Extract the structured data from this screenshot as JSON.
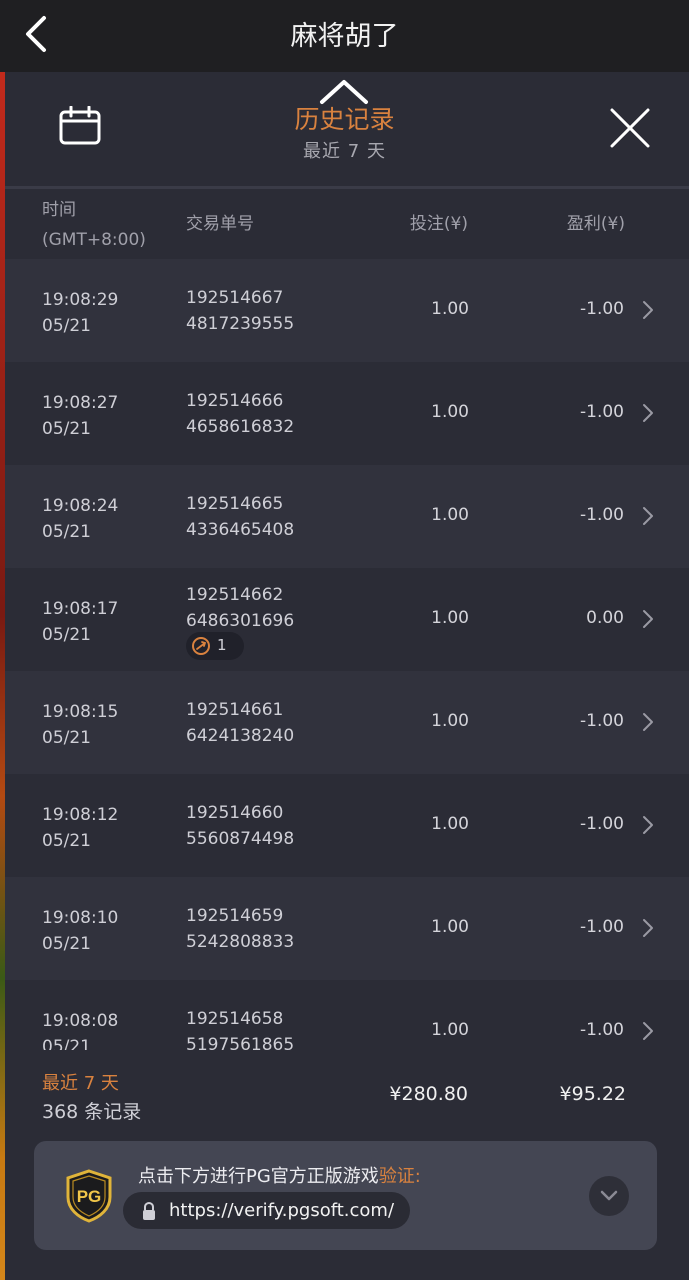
{
  "app": {
    "title": "麻将胡了"
  },
  "panel": {
    "title": "历史记录",
    "subtitle": "最近 7 天",
    "title_color": "#d9823f"
  },
  "columns": {
    "time_line1": "时间",
    "time_line2": "(GMT+8:00)",
    "transaction": "交易单号",
    "bet": "投注(¥)",
    "profit": "盈利(¥)"
  },
  "rows": [
    {
      "time": "19:08:29",
      "date": "05/21",
      "tx1": "192514667",
      "tx2": "4817239555",
      "bet": "1.00",
      "profit": "-1.00"
    },
    {
      "time": "19:08:27",
      "date": "05/21",
      "tx1": "192514666",
      "tx2": "4658616832",
      "bet": "1.00",
      "profit": "-1.00"
    },
    {
      "time": "19:08:24",
      "date": "05/21",
      "tx1": "192514665",
      "tx2": "4336465408",
      "bet": "1.00",
      "profit": "-1.00"
    },
    {
      "time": "19:08:17",
      "date": "05/21",
      "tx1": "192514662",
      "tx2": "6486301696",
      "bet": "1.00",
      "profit": "0.00",
      "badge": "1"
    },
    {
      "time": "19:08:15",
      "date": "05/21",
      "tx1": "192514661",
      "tx2": "6424138240",
      "bet": "1.00",
      "profit": "-1.00"
    },
    {
      "time": "19:08:12",
      "date": "05/21",
      "tx1": "192514660",
      "tx2": "5560874498",
      "bet": "1.00",
      "profit": "-1.00"
    },
    {
      "time": "19:08:10",
      "date": "05/21",
      "tx1": "192514659",
      "tx2": "5242808833",
      "bet": "1.00",
      "profit": "-1.00"
    },
    {
      "time": "19:08:08",
      "date": "05/21",
      "tx1": "192514658",
      "tx2": "5197561865",
      "bet": "1.00",
      "profit": "-1.00"
    }
  ],
  "footer": {
    "period": "最近 7 天",
    "count": "368 条记录",
    "total_bet": "¥280.80",
    "total_profit": "¥95.22"
  },
  "verify": {
    "prompt": "点击下方进行PG官方正版游戏",
    "prompt_accent": "验证:",
    "url": "https://verify.pgsoft.com/",
    "logo_text": "PG"
  },
  "icons": {
    "back": "back-chevron-icon",
    "calendar": "calendar-icon",
    "collapse": "chevron-up-icon",
    "close": "close-icon",
    "row": "chevron-right-icon",
    "lock": "lock-icon",
    "expand": "chevron-down-icon"
  }
}
